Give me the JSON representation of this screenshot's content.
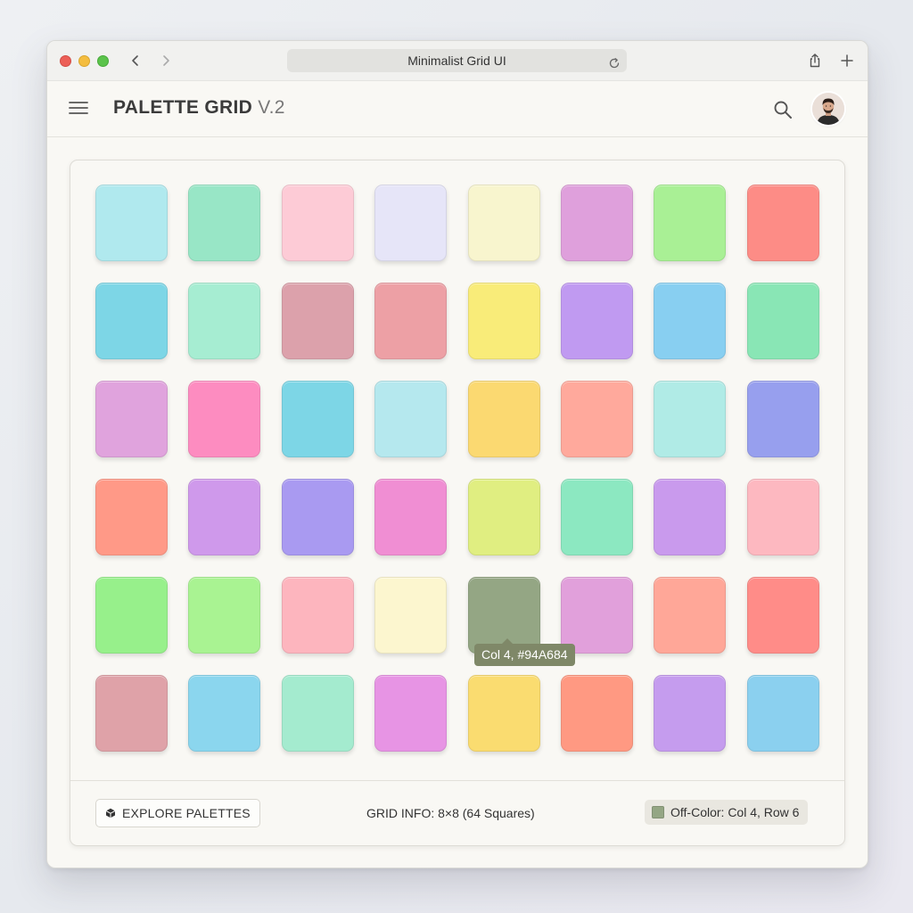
{
  "browser": {
    "url_title": "Minimalist Grid UI"
  },
  "header": {
    "title": "PALETTE GRID",
    "version": "V.2"
  },
  "grid": {
    "rows": [
      [
        "#B0E9EE",
        "#98E6C6",
        "#FDCBD6",
        "#E6E5F8",
        "#F8F5CE",
        "#DFA0DC",
        "#A9F095",
        "#FD8C86"
      ],
      [
        "#7DD6E6",
        "#A6EDD2",
        "#DCA1AB",
        "#EDA0A5",
        "#F9EC79",
        "#C09AF1",
        "#88CFF1",
        "#89E6B5"
      ],
      [
        "#E0A3DD",
        "#FD8CC0",
        "#7DD6E6",
        "#B5E8EE",
        "#FBD971",
        "#FFA99C",
        "#B0EBE6",
        "#979FEE"
      ],
      [
        "#FF9987",
        "#CF99EB",
        "#A99AF1",
        "#F08ED3",
        "#E0EE81",
        "#8CE8C1",
        "#C99AED",
        "#FDB8C0"
      ],
      [
        "#97F08B",
        "#A9F392",
        "#FDB5BE",
        "#FCF6CF",
        "#94A684",
        "#E1A0DB",
        "#FFA798",
        "#FF8C88"
      ],
      [
        "#DFA2A8",
        "#8BD6EE",
        "#A4EBCF",
        "#E794E4",
        "#FADC70",
        "#FF9982",
        "#C59CEE",
        "#8BD0EF"
      ]
    ]
  },
  "tooltip": {
    "text": "Col 4, #94A684"
  },
  "footer": {
    "explore_label": "EXPLORE PALETTES",
    "grid_info": "GRID INFO: 8×8 (64 Squares)",
    "offcolor_label": "Off-Color: Col 4, Row 6",
    "offcolor_swatch": "#94A684"
  }
}
